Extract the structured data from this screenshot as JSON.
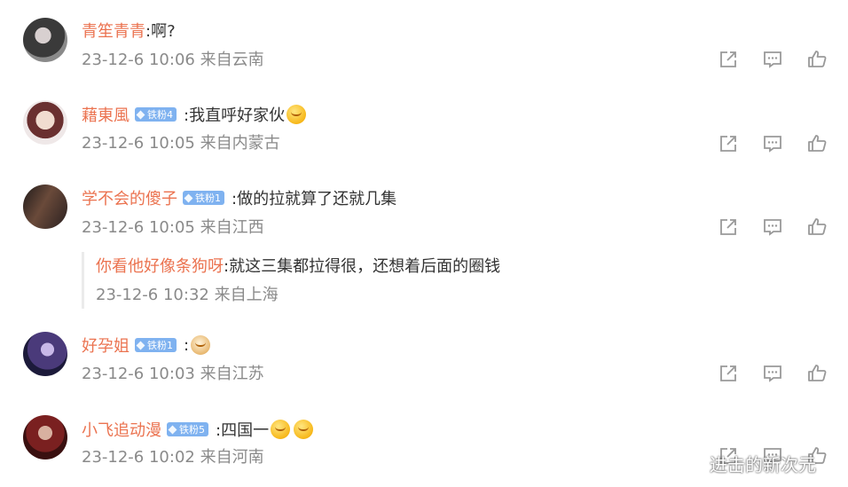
{
  "comments": [
    {
      "user": "青笙青青",
      "badge": "",
      "text": ":啊?",
      "time": "23-12-6 10:06 来自云南",
      "emojis": []
    },
    {
      "user": "藉東風",
      "badge": "铁粉4",
      "text": ":我直呼好家伙",
      "time": "23-12-6 10:05 来自内蒙古",
      "emojis": [
        "666-emoji"
      ]
    },
    {
      "user": "学不会的傻子",
      "badge": "铁粉1",
      "text": ":做的拉就算了还就几集",
      "time": "23-12-6 10:05 来自江西",
      "emojis": []
    },
    {
      "user": "好孕姐",
      "badge": "铁粉1",
      "text": ":",
      "time": "23-12-6 10:03 来自江苏",
      "emojis": [
        "doge-emoji"
      ]
    },
    {
      "user": "小飞追动漫",
      "badge": "铁粉5",
      "text": ":四国一",
      "time": "23-12-6 10:02 来自河南",
      "emojis": [
        "smile-emoji",
        "smile-emoji"
      ]
    }
  ],
  "reply": {
    "user": "你看他好像条狗呀",
    "text": ":就这三集都拉得很，还想着后面的圈钱",
    "time": "23-12-6 10:32 来自上海"
  },
  "icons": [
    "share-icon",
    "comment-icon",
    "like-icon"
  ],
  "watermark": "进击的新次元",
  "colors": {
    "username": "#eb7350",
    "text": "#333333",
    "meta": "#8a8a8a",
    "badge": "#7fb2f0",
    "icon": "#999999"
  }
}
